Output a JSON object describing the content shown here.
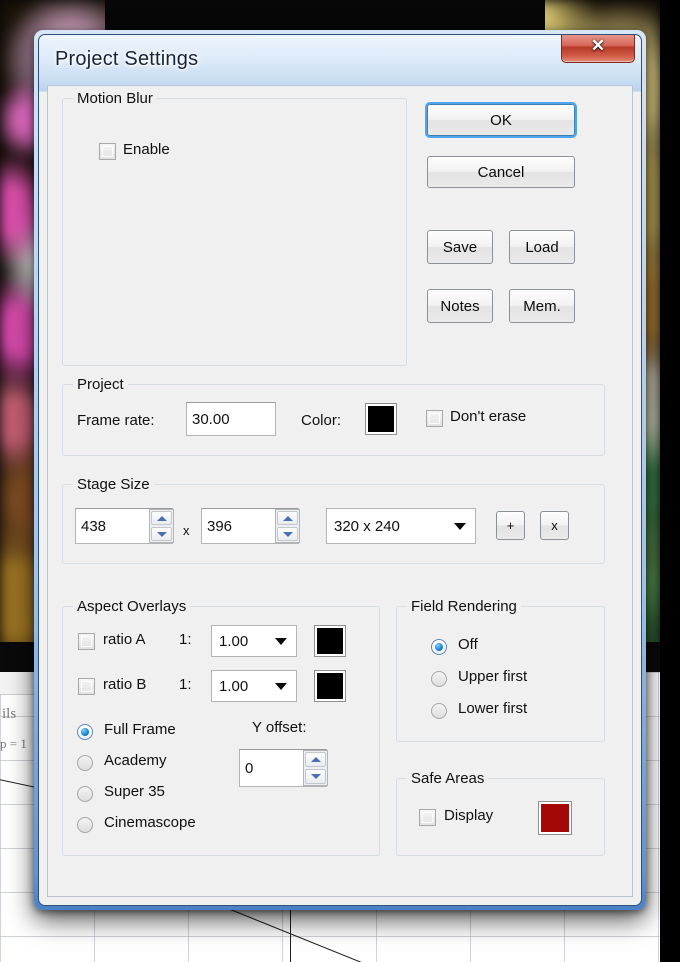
{
  "window": {
    "title": "Project Settings",
    "close_label": "Close"
  },
  "buttons": {
    "ok": "OK",
    "cancel": "Cancel",
    "save": "Save",
    "load": "Load",
    "notes": "Notes",
    "mem": "Mem."
  },
  "motion_blur": {
    "title": "Motion Blur",
    "enable_label": "Enable",
    "enable_checked": false
  },
  "project": {
    "title": "Project",
    "frame_rate_label": "Frame rate:",
    "frame_rate_value": "30.00",
    "color_label": "Color:",
    "color_value": "#000000",
    "dont_erase_label": "Don't erase",
    "dont_erase_checked": false
  },
  "stage_size": {
    "title": "Stage Size",
    "width_value": "438",
    "separator": "x",
    "height_value": "396",
    "preset_value": "320 x 240",
    "add_label": "+",
    "remove_label": "x"
  },
  "aspect_overlays": {
    "title": "Aspect Overlays",
    "ratio_a": {
      "label": "ratio A",
      "prefix": "1:",
      "value": "1.00",
      "color": "#000000",
      "checked": false
    },
    "ratio_b": {
      "label": "ratio B",
      "prefix": "1:",
      "value": "1.00",
      "color": "#000000",
      "checked": false
    },
    "frame_options": [
      {
        "label": "Full Frame",
        "selected": true
      },
      {
        "label": "Academy",
        "selected": false
      },
      {
        "label": "Super 35",
        "selected": false
      },
      {
        "label": "Cinemascope",
        "selected": false
      }
    ],
    "y_offset_label": "Y offset:",
    "y_offset_value": "0"
  },
  "field_rendering": {
    "title": "Field Rendering",
    "options": [
      {
        "label": "Off",
        "selected": true
      },
      {
        "label": "Upper first",
        "selected": false
      },
      {
        "label": "Lower first",
        "selected": false
      }
    ]
  },
  "safe_areas": {
    "title": "Safe Areas",
    "display_label": "Display",
    "display_checked": false,
    "color_value": "#A50707"
  },
  "background": {
    "document_text_1": "ils",
    "document_text_2": "p = 1"
  }
}
